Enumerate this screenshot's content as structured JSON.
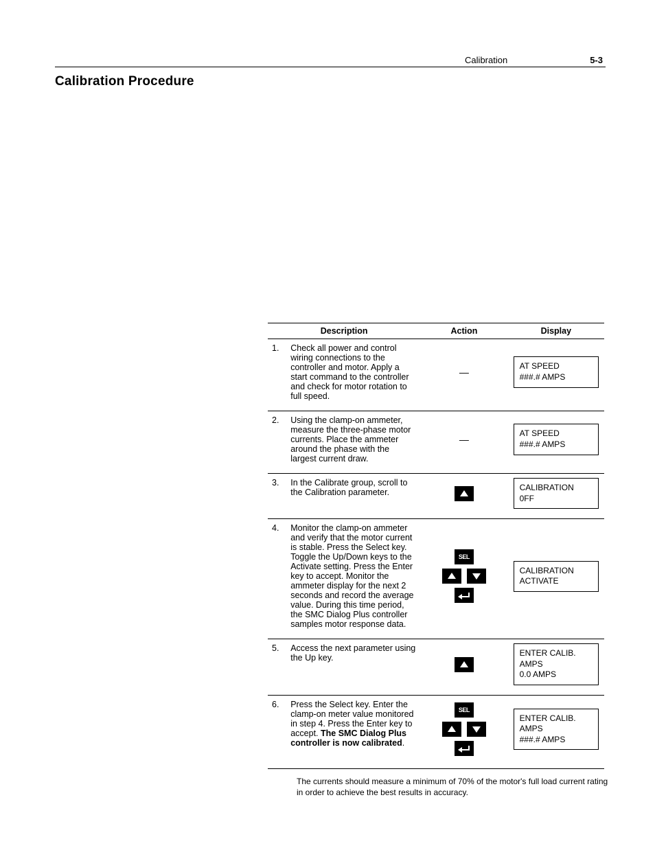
{
  "header": {
    "chapter": "Calibration",
    "pagenum": "5-3"
  },
  "section_title": "Calibration Procedure",
  "table": {
    "headers": {
      "description": "Description",
      "action": "Action",
      "display": "Display"
    },
    "rows": [
      {
        "num": "1.",
        "desc": "Check all power and control wiring connections to the controller and motor. Apply a start command to the controller and check for motor rotation to full speed.",
        "action_dash": "—",
        "display_l1": "AT SPEED",
        "display_l2": "###.# AMPS"
      },
      {
        "num": "2.",
        "desc": "Using the clamp-on ammeter, measure the three-phase motor currents. Place the ammeter around the phase with the largest current draw.",
        "action_dash": "—",
        "display_l1": "AT SPEED",
        "display_l2": "###.# AMPS"
      },
      {
        "num": "3.",
        "desc": "In the Calibrate group, scroll to the Calibration parameter.",
        "display_l1": "CALIBRATION",
        "display_l2": "0FF"
      },
      {
        "num": "4.",
        "desc": "Monitor the clamp-on ammeter and verify that the motor current is stable. Press the Select key. Toggle the Up/Down keys to the Activate setting. Press the Enter key to accept. Monitor the ammeter display for the next 2 seconds and record the average value. During this time period, the SMC Dialog Plus controller samples motor response data.",
        "display_l1": "CALIBRATION",
        "display_l2": "ACTIVATE"
      },
      {
        "num": "5.",
        "desc": "Access the next parameter using the Up key.",
        "display_l1": "ENTER CALIB. AMPS",
        "display_l2": "0.0 AMPS"
      },
      {
        "num": "6.",
        "desc_part1": "Press the Select key.  Enter the clamp-on meter value monitored in step 4. Press the Enter key to accept. ",
        "desc_bold1": "The SMC Dialog Plus controller is now calibrated",
        "desc_part2": ".",
        "display_l1": "ENTER CALIB. AMPS",
        "display_l2": "###.# AMPS"
      }
    ]
  },
  "keys": {
    "sel_label": "SEL"
  },
  "footnote": "The currents should measure a minimum of 70% of the motor's full load current rating in order to achieve the best results in accuracy."
}
